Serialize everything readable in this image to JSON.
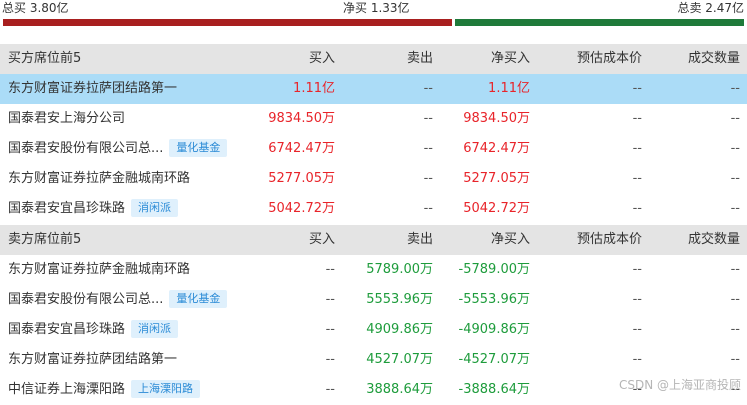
{
  "summary": {
    "total_buy": "总买 3.80亿",
    "net_buy": "净买 1.33亿",
    "total_sell": "总卖 2.47亿",
    "buy_share": 0.606,
    "buy_color": "#a81f1f",
    "sell_color": "#1f7a3a"
  },
  "buy_table": {
    "headers": [
      "买方席位前5",
      "买入",
      "卖出",
      "净买入",
      "预估成本价",
      "成交数量"
    ],
    "rows": [
      {
        "name": "东方财富证券拉萨团结路第一",
        "tag": "",
        "buy": "1.11亿",
        "sell": "--",
        "net": "1.11亿",
        "cost": "--",
        "volume": "--"
      },
      {
        "name": "国泰君安上海分公司",
        "tag": "",
        "buy": "9834.50万",
        "sell": "--",
        "net": "9834.50万",
        "cost": "--",
        "volume": "--"
      },
      {
        "name": "国泰君安股份有限公司总...",
        "tag": "量化基金",
        "buy": "6742.47万",
        "sell": "--",
        "net": "6742.47万",
        "cost": "--",
        "volume": "--"
      },
      {
        "name": "东方财富证券拉萨金融城南环路",
        "tag": "",
        "buy": "5277.05万",
        "sell": "--",
        "net": "5277.05万",
        "cost": "--",
        "volume": "--"
      },
      {
        "name": "国泰君安宜昌珍珠路",
        "tag": "消闲派",
        "buy": "5042.72万",
        "sell": "--",
        "net": "5042.72万",
        "cost": "--",
        "volume": "--"
      }
    ]
  },
  "sell_table": {
    "headers": [
      "卖方席位前5",
      "买入",
      "卖出",
      "净买入",
      "预估成本价",
      "成交数量"
    ],
    "rows": [
      {
        "name": "东方财富证券拉萨金融城南环路",
        "tag": "",
        "buy": "--",
        "sell": "5789.00万",
        "net": "-5789.00万",
        "cost": "--",
        "volume": "--"
      },
      {
        "name": "国泰君安股份有限公司总...",
        "tag": "量化基金",
        "buy": "--",
        "sell": "5553.96万",
        "net": "-5553.96万",
        "cost": "--",
        "volume": "--"
      },
      {
        "name": "国泰君安宜昌珍珠路",
        "tag": "消闲派",
        "buy": "--",
        "sell": "4909.86万",
        "net": "-4909.86万",
        "cost": "--",
        "volume": "--"
      },
      {
        "name": "东方财富证券拉萨团结路第一",
        "tag": "",
        "buy": "--",
        "sell": "4527.07万",
        "net": "-4527.07万",
        "cost": "--",
        "volume": "--"
      },
      {
        "name": "中信证券上海溧阳路",
        "tag": "上海溧阳路",
        "buy": "--",
        "sell": "3888.64万",
        "net": "-3888.64万",
        "cost": "--",
        "volume": "--"
      }
    ]
  },
  "watermark": "CSDN @上海亚商投顾"
}
